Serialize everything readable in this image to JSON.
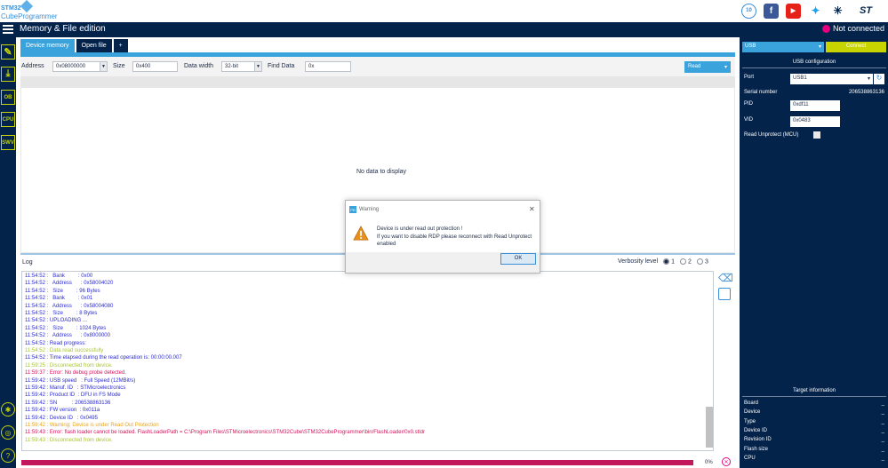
{
  "app": {
    "logo_line1": "STM32",
    "logo_line2": "CubeProgrammer",
    "page_title": "Memory & File edition",
    "connection_status": "Not connected"
  },
  "sidebar": {
    "items": [
      {
        "label": "",
        "icon": "pencil-icon"
      },
      {
        "label": "",
        "icon": "download-icon"
      },
      {
        "label": "OB"
      },
      {
        "label": "CPU"
      },
      {
        "label": "SWV"
      }
    ]
  },
  "tabs": [
    {
      "label": "Device memory"
    },
    {
      "label": "Open file"
    },
    {
      "label": "+"
    }
  ],
  "toolbar": {
    "address_label": "Address",
    "address_value": "0x08000000",
    "size_label": "Size",
    "size_value": "0x400",
    "width_label": "Data width",
    "width_value": "32-bit",
    "find_label": "Find Data",
    "find_value": "0x",
    "read_label": "Read"
  },
  "main": {
    "empty_text": "No data to display"
  },
  "log": {
    "label": "Log",
    "verbosity_label": "Verbosity level",
    "levels": [
      "1",
      "2",
      "3"
    ],
    "lines": [
      {
        "t": "11:54:52 :   Bank         : 0x00",
        "c": "#2b2bd6"
      },
      {
        "t": "11:54:52 :   Address      : 0x58004020",
        "c": "#2b2bd6"
      },
      {
        "t": "11:54:52 :   Size         : 96 Bytes",
        "c": "#2b2bd6"
      },
      {
        "t": "11:54:52 :   Bank         : 0x01",
        "c": "#2b2bd6"
      },
      {
        "t": "11:54:52 :   Address      : 0x58004080",
        "c": "#2b2bd6"
      },
      {
        "t": "11:54:52 :   Size         : 8 Bytes",
        "c": "#2b2bd6"
      },
      {
        "t": "11:54:52 : UPLOADING ...",
        "c": "#2b2bd6"
      },
      {
        "t": "11:54:52 :   Size         : 1024 Bytes",
        "c": "#2b2bd6"
      },
      {
        "t": "11:54:52 :   Address      : 0x8000000",
        "c": "#2b2bd6"
      },
      {
        "t": "11:54:52 : Read progress:",
        "c": "#2b2bd6"
      },
      {
        "t": "11:54:52 : Data read successfully",
        "c": "#a8c43a"
      },
      {
        "t": "11:54:52 : Time elapsed during the read operation is: 00:00:00.007",
        "c": "#2b2bd6"
      },
      {
        "t": "11:59:25 : Disconnected from device.",
        "c": "#a8c43a"
      },
      {
        "t": "11:59:37 : Error: No debug probe detected.",
        "c": "#d4145a"
      },
      {
        "t": "11:59:42 : USB speed   : Full Speed (12MBit/s)",
        "c": "#2b2bd6"
      },
      {
        "t": "11:59:42 : Manuf. ID   : STMicroelectronics",
        "c": "#2b2bd6"
      },
      {
        "t": "11:59:42 : Product ID  : DFU in FS Mode",
        "c": "#2b2bd6"
      },
      {
        "t": "11:59:42 : SN          : 206538863136",
        "c": "#2b2bd6"
      },
      {
        "t": "11:59:42 : FW version  : 0x011a",
        "c": "#2b2bd6"
      },
      {
        "t": "11:59:42 : Device ID   : 0x0495",
        "c": "#2b2bd6"
      },
      {
        "t": "11:59:42 : Warning: Device is under Read Out Protection",
        "c": "#e8a317"
      },
      {
        "t": "11:59:43 : Error: flash loader cannot be loaded. FlashLoaderPath = C:\\Program Files\\STMicroelectronics\\STM32Cube\\STM32CubeProgrammer\\bin/FlashLoader/0x0.stldr",
        "c": "#d4145a"
      },
      {
        "t": "11:59:43 : Disconnected from device.",
        "c": "#a8c43a"
      }
    ],
    "progress_percent": "0%"
  },
  "right_panel": {
    "interface": "USB",
    "connect_label": "Connect",
    "config_title": "USB configuration",
    "port_label": "Port",
    "port_value": "USB1",
    "serial_label": "Serial number",
    "serial_value": "206538863136",
    "pid_label": "PID",
    "pid_value": "0xdf11",
    "vid_label": "VID",
    "vid_value": "0x0483",
    "unprotect_label": "Read Unprotect (MCU)",
    "target_title": "Target information",
    "target_rows": [
      {
        "label": "Board",
        "value": "_"
      },
      {
        "label": "Device",
        "value": "_"
      },
      {
        "label": "Type",
        "value": "_"
      },
      {
        "label": "Device ID",
        "value": "_"
      },
      {
        "label": "Revision ID",
        "value": "_"
      },
      {
        "label": "Flash size",
        "value": "_"
      },
      {
        "label": "CPU",
        "value": "_"
      }
    ]
  },
  "dialog": {
    "title": "Warning",
    "message_line1": "Device is under read out protection !",
    "message_line2": "If you want to disable RDP please reconnect with Read Unprotect enabled",
    "ok_label": "OK"
  },
  "colors": {
    "navy": "#03234b",
    "accent": "#3ba3dc",
    "lime": "#c8d400",
    "magenta": "#e6007e"
  }
}
